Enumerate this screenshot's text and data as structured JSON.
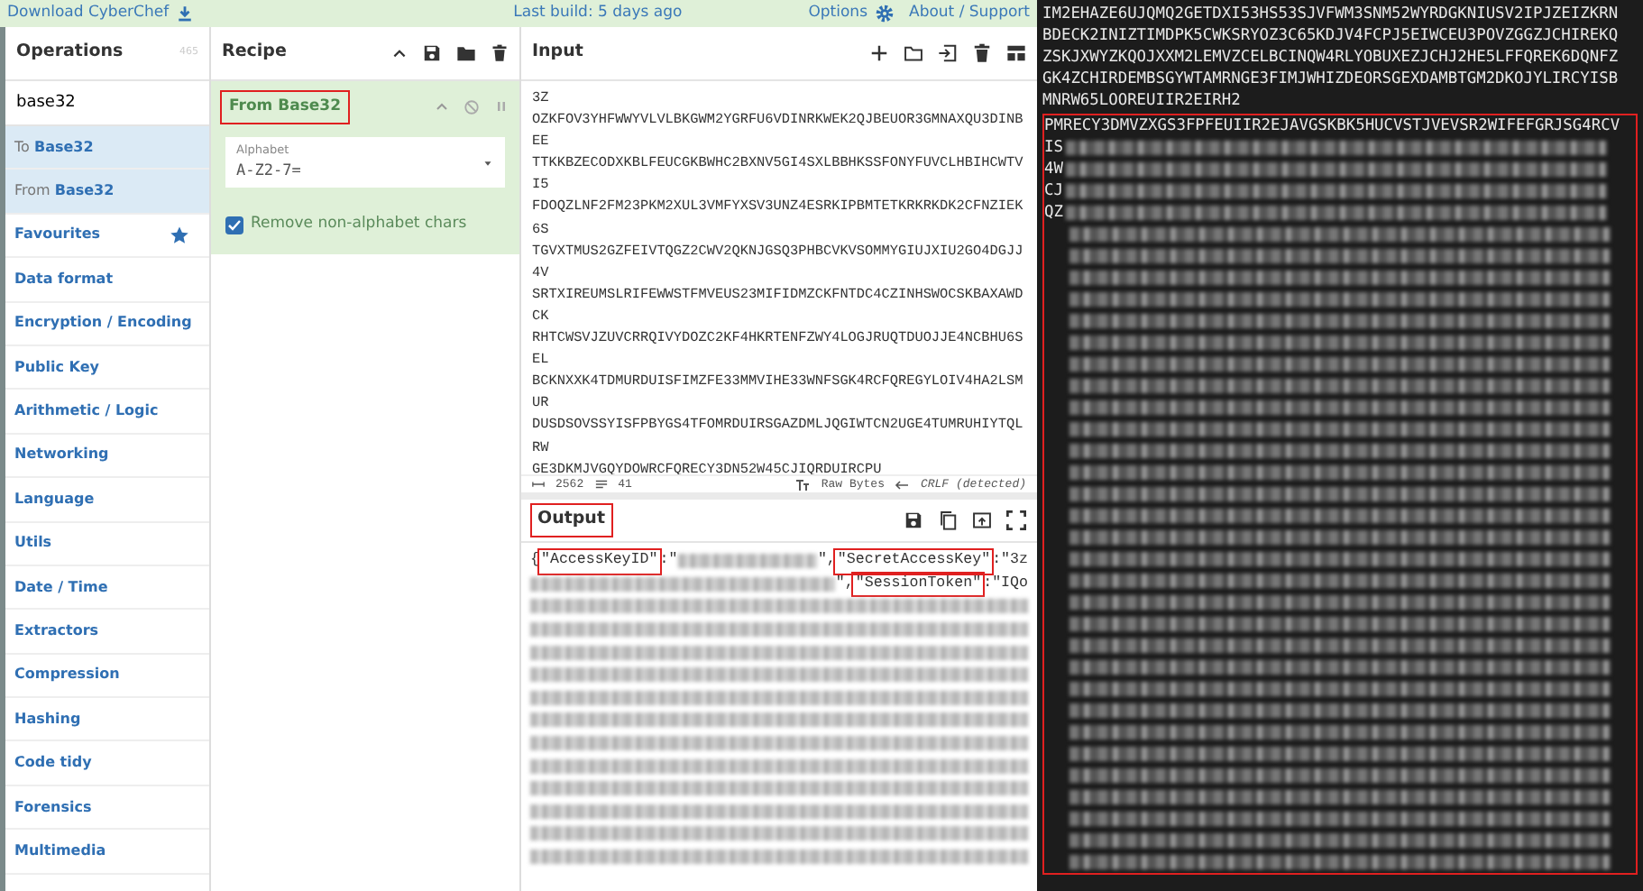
{
  "top_bar": {
    "download_link": "Download CyberChef",
    "last_build": "Last build: 5 days ago",
    "options": "Options",
    "about": "About / Support"
  },
  "operations": {
    "title": "Operations",
    "count": "465",
    "search": {
      "value": "base32"
    },
    "items": [
      {
        "kind": "result",
        "label": "To **Base32**",
        "selected": true
      },
      {
        "kind": "result",
        "label": "From **Base32**",
        "selected": true
      },
      {
        "kind": "favourites",
        "label": "Favourites",
        "selected": false
      },
      {
        "kind": "category",
        "label": "Data format",
        "selected": false
      },
      {
        "kind": "category",
        "label": "Encryption / Encoding",
        "selected": false
      },
      {
        "kind": "category",
        "label": "Public Key",
        "selected": false
      },
      {
        "kind": "category",
        "label": "Arithmetic / Logic",
        "selected": false
      },
      {
        "kind": "category",
        "label": "Networking",
        "selected": false
      },
      {
        "kind": "category",
        "label": "Language",
        "selected": false
      },
      {
        "kind": "category",
        "label": "Utils",
        "selected": false
      },
      {
        "kind": "category",
        "label": "Date / Time",
        "selected": false
      },
      {
        "kind": "category",
        "label": "Extractors",
        "selected": false
      },
      {
        "kind": "category",
        "label": "Compression",
        "selected": false
      },
      {
        "kind": "category",
        "label": "Hashing",
        "selected": false
      },
      {
        "kind": "category",
        "label": "Code tidy",
        "selected": false
      },
      {
        "kind": "category",
        "label": "Forensics",
        "selected": false
      },
      {
        "kind": "category",
        "label": "Multimedia",
        "selected": false
      }
    ]
  },
  "recipe": {
    "title": "Recipe",
    "steps": [
      {
        "title": "From Base32",
        "highlighted": true,
        "alphabet": {
          "label": "Alphabet",
          "value": "A-Z2-7="
        },
        "option": {
          "label": "Remove non-alphabet chars",
          "checked": true
        }
      }
    ]
  },
  "input": {
    "title": "Input",
    "lines": [
      "3Z",
      "OZKFOV3YHFWWYVLVLBKGWM2YGRFU6VDINRKWEK2QJBEUOR3GMNAXQU3DINB",
      "EE",
      "TTKKBZECODXKBLFEUCGKBWHC2BXNV5GI4SXLBBHKSSFONYFUVCLHBIHCWTV",
      "I5",
      "FDOQZLNF2FM23PKM2XUL3VMFYXSV3UNZ4ESRKIPBMTETKRKRKDK2CFNZIEK",
      "6S",
      "TGVXTMUS2GZFEIVTQGZ2CWV2QKNJGSQ3PHBCVKVSOMMYGIUJXIU2GO4DGJJ",
      "4V",
      "SRTXIREUMSLRIFEWWSTFMVEUS23MIFIDMZCKFNTDC4CZINHSWOCSKBAXAWD",
      "CK",
      "RHTCWSVJZUVCRRQIVYDOZC2KF4HKRTENFZWY4LOGJRUQTDUOJJE4NCBHU6S",
      "EL",
      "BCKNXXK4TDMURDUISFIMZFE33MMVIHE33WNFSGK4RCFQREGYLOIV4HA2LSM",
      "UR",
      "DUSDSOVSSYISFPBYGS4TFOMRDUIRSGAZDMLJQGIWTCN2UGE4TUMRUHIYTQL",
      "RW",
      "GE3DKMJVGQYDOWRCFQRECY3DN52W45CJIQRDUIRCPU"
    ],
    "length": "2562",
    "line_count": "41",
    "encoding": "Raw Bytes",
    "eol": "CRLF (detected)"
  },
  "output": {
    "title": "Output",
    "highlighted": true,
    "lines": [
      [
        {
          "kind": "text",
          "text": "{"
        },
        {
          "kind": "key",
          "text": "\"AccessKeyID\""
        },
        {
          "kind": "text",
          "text": ":\""
        },
        {
          "kind": "redacted"
        },
        {
          "kind": "text",
          "text": "\","
        },
        {
          "kind": "key",
          "text": "\"SecretAccessKey\""
        },
        {
          "kind": "text",
          "text": ":\"3z"
        }
      ],
      [
        {
          "kind": "redacted"
        },
        {
          "kind": "text",
          "text": "\","
        },
        {
          "kind": "key",
          "text": "\"SessionToken\""
        },
        {
          "kind": "text",
          "text": ":\"IQo"
        }
      ],
      [
        {
          "kind": "redacted"
        }
      ],
      [
        {
          "kind": "redacted"
        }
      ],
      [
        {
          "kind": "redacted"
        }
      ],
      [
        {
          "kind": "redacted"
        }
      ],
      [
        {
          "kind": "redacted"
        }
      ],
      [
        {
          "kind": "redacted"
        }
      ],
      [
        {
          "kind": "redacted"
        }
      ],
      [
        {
          "kind": "redacted"
        }
      ],
      [
        {
          "kind": "redacted"
        }
      ],
      [
        {
          "kind": "redacted"
        }
      ],
      [
        {
          "kind": "redacted"
        }
      ],
      [
        {
          "kind": "redacted"
        }
      ]
    ]
  },
  "terminal": {
    "lines": [
      "IM2EHAZE6UJQMQ2GETDXI53HS53SJVFWM3SNM52WYRDGKNIUSV2IPJZEIZKRN",
      "BDECK2INIZTIMDPK5CWKSRYOZ3C65KDJV4FCPJ5EIWCEU3POVZGGZJCHIREKQ",
      "ZSKJXWYZKQOJXXM2LEMVZCELBCINQW4RLYOBUXEZJCHJ2HE5LFFQREK6DQNFZ",
      "GK4ZCHIRDEMBSGYWTAMRNGE3FIMJWHIZDEORSGEXDAMBTGM2DKOJYLIRCYISB",
      "MNRW65LOOREUIIR2EIRH2"
    ],
    "highlighted_block": {
      "first_line": "PMRECY3DMVZXGS3FPFEUIIR2EJAVGSKBK5HUCVSTJVEVSR2WIFEFGRJSG4RCV",
      "rows": [
        {
          "prefix": "IS"
        },
        {
          "prefix": "4W"
        },
        {
          "prefix": "CJ"
        },
        {
          "prefix": "QZ"
        },
        {},
        {},
        {},
        {},
        {},
        {},
        {},
        {},
        {},
        {},
        {},
        {},
        {},
        {},
        {},
        {},
        {},
        {},
        {},
        {},
        {},
        {},
        {},
        {},
        {},
        {},
        {},
        {},
        {},
        {}
      ]
    }
  }
}
